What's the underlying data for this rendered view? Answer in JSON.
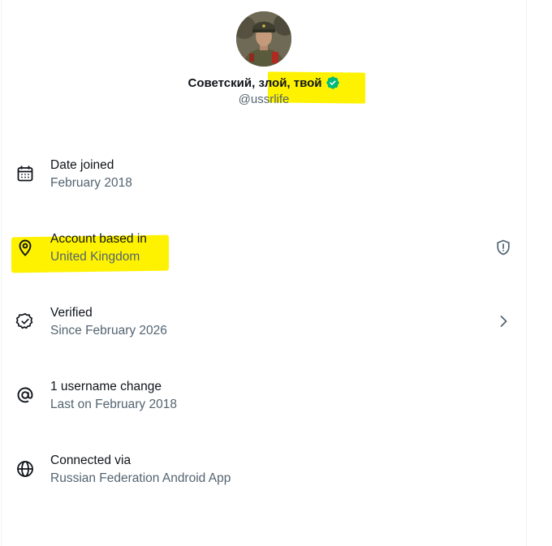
{
  "profile": {
    "display_name": "Советский, злой, твой",
    "handle": "@ussrlife",
    "verified": true,
    "badge_color": "#00ba7c"
  },
  "highlight_color": "#fff200",
  "about": [
    {
      "icon": "calendar-icon",
      "title": "Date joined",
      "subtitle": "February 2018"
    },
    {
      "icon": "location-pin-icon",
      "title": "Account based in",
      "subtitle": "United Kingdom",
      "right_icon": "shield-alert-icon"
    },
    {
      "icon": "verified-outline-icon",
      "title": "Verified",
      "subtitle": "Since February 2026",
      "right_icon": "chevron-right-icon"
    },
    {
      "icon": "at-sign-icon",
      "title": "1 username change",
      "subtitle": "Last on February 2018"
    },
    {
      "icon": "globe-icon",
      "title": "Connected via",
      "subtitle": "Russian Federation Android App"
    }
  ]
}
